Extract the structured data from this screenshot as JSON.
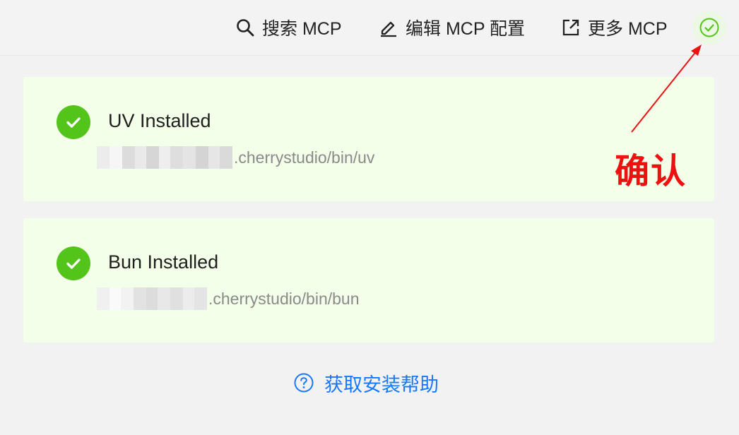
{
  "toolbar": {
    "search_label": "搜索 MCP",
    "edit_label": "编辑 MCP 配置",
    "more_label": "更多 MCP",
    "icons": {
      "search": "search-icon",
      "edit": "pencil-icon",
      "more": "external-link-icon",
      "confirm": "check-circle-icon"
    }
  },
  "cards": [
    {
      "title": "UV Installed",
      "path_suffix": ".cherrystudio/bin/uv",
      "path_prefix_redacted": true,
      "status": "installed"
    },
    {
      "title": "Bun Installed",
      "path_suffix": ".cherrystudio/bin/bun",
      "path_prefix_redacted": true,
      "status": "installed"
    }
  ],
  "help": {
    "label": "获取安装帮助",
    "icon": "question-circle-icon"
  },
  "annotation": {
    "text": "确认",
    "color": "#ee1111"
  },
  "colors": {
    "success": "#52c41a",
    "card_background": "#f4ffe9",
    "link": "#1677ff",
    "page_background": "#f2f2f2"
  }
}
